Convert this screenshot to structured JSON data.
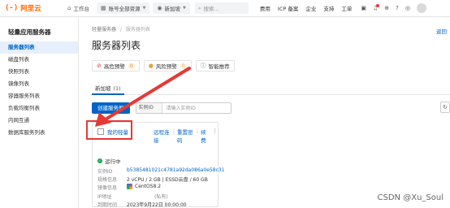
{
  "topbar": {
    "logo_text": "阿里云",
    "workbench": "工作台",
    "account_resources": "账号全部资源",
    "region": "新加坡",
    "search_placeholder": "搜索...",
    "links": [
      "费用",
      "ICP 备案",
      "企业",
      "支持",
      "工单"
    ]
  },
  "sidebar": {
    "title": "轻量应用服务器",
    "items": [
      {
        "label": "服务器列表",
        "active": true
      },
      {
        "label": "磁盘列表",
        "active": false
      },
      {
        "label": "快照列表",
        "active": false
      },
      {
        "label": "镜像列表",
        "active": false
      },
      {
        "label": "容器服务列表",
        "active": false
      },
      {
        "label": "负载均衡列表",
        "active": false
      },
      {
        "label": "内网互通",
        "active": false
      },
      {
        "label": "数据库服务列表",
        "active": false
      }
    ]
  },
  "breadcrumb": {
    "root": "轻量服务器",
    "separator": "/",
    "current": "服务器列表"
  },
  "right_link": "返回",
  "page_title": "服务器列表",
  "alerts": [
    {
      "label": "高危预警",
      "count": "0"
    },
    {
      "label": "风险预警",
      "count": "0"
    },
    {
      "label": "智能推荐",
      "count": ""
    }
  ],
  "tabs": [
    {
      "label": "新加坡",
      "count": "(1)"
    }
  ],
  "toolbar": {
    "create_button": "创建服务器",
    "filter_select": "实例ID",
    "filter_placeholder": "请输入实例ID"
  },
  "instance": {
    "name": "我的轻量",
    "actions": [
      "远程连接",
      "重置密码",
      "续费"
    ],
    "status": "运行中",
    "fields": [
      {
        "key": "实例ID",
        "value": "b5385481021c4781a92da086a0e58c31"
      },
      {
        "key": "规格信息",
        "value": "2 vCPU / 2 GB | ESSD云盘 / 60 GB"
      },
      {
        "key": "镜像信息",
        "value": "CentOS8.2"
      },
      {
        "key": "IP地址",
        "value": "(私有)"
      },
      {
        "key": "到期时间",
        "value": "2023年9月22日 00:00:00"
      }
    ]
  },
  "watermark": "CSDN @Xu_Soul",
  "colors": {
    "accent": "#0064c8",
    "brand": "#ff6a00",
    "highlight": "#e53935",
    "running": "#1aa94c"
  }
}
